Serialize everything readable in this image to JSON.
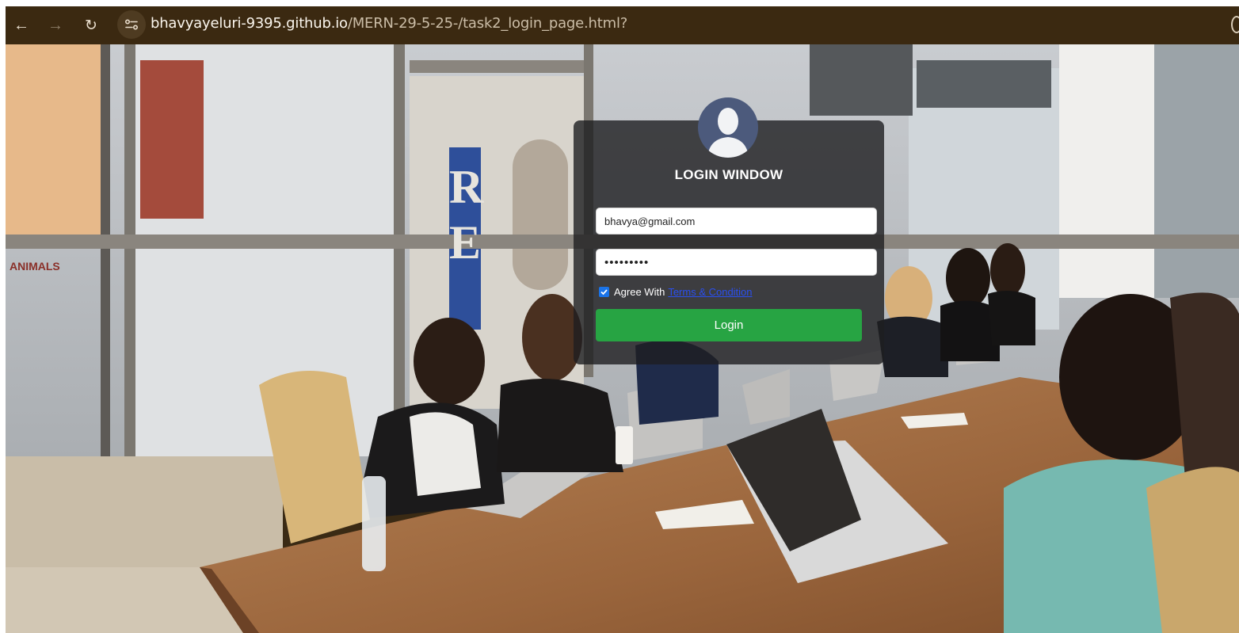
{
  "browser": {
    "url_host": "bhavyayeluri-9395.github.io",
    "url_path": "/MERN-29-5-25-/task2_login_page.html?",
    "icons": {
      "back": "arrow-left-icon",
      "forward": "arrow-right-icon",
      "reload": "reload-icon",
      "site_info": "tune-icon"
    }
  },
  "login": {
    "title": "LOGIN WINDOW",
    "email_value": "bhavya@gmail.com",
    "password_value": "•••••••••",
    "agree_text": "Agree With",
    "terms_link": "Terms & Condition",
    "agree_checked": true,
    "login_button": "Login",
    "colors": {
      "card_bg": "#1e1e20",
      "button": "#27a443",
      "avatar_bg": "#4c5a7c",
      "link": "#2a4ff0"
    }
  },
  "background": {
    "description_icon": "office-meeting-photo"
  }
}
